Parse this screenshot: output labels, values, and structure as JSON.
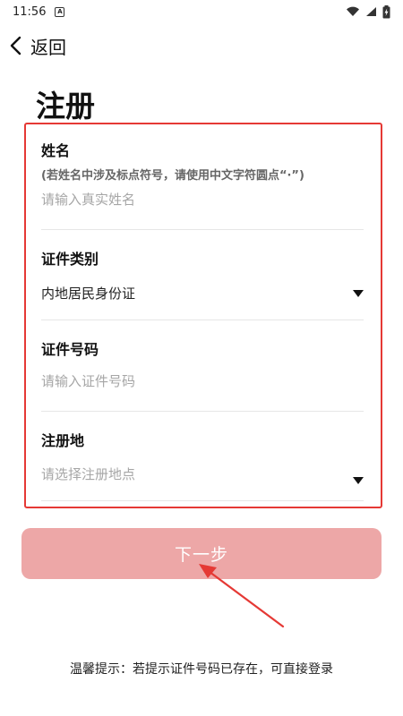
{
  "status_bar": {
    "time": "11:56",
    "notification_icon": "a-notification-icon",
    "wifi_icon": "wifi-icon",
    "signal_icon": "signal-icon",
    "battery_icon": "battery-charging-icon"
  },
  "nav": {
    "back_label": "返回"
  },
  "page": {
    "title": "注册"
  },
  "form": {
    "name": {
      "label": "姓名",
      "hint": "(若姓名中涉及标点符号，请使用中文字符圆点“·”)",
      "placeholder": "请输入真实姓名"
    },
    "id_type": {
      "label": "证件类别",
      "value": "内地居民身份证"
    },
    "id_number": {
      "label": "证件号码",
      "placeholder": "请输入证件号码"
    },
    "region": {
      "label": "注册地",
      "placeholder": "请选择注册地点"
    }
  },
  "actions": {
    "next_label": "下一步"
  },
  "footer": {
    "tip": "温馨提示：若提示证件号码已存在，可直接登录"
  },
  "colors": {
    "highlight_border": "#e53935",
    "button_bg": "#eda7a7",
    "annotation_arrow": "#e53935"
  }
}
